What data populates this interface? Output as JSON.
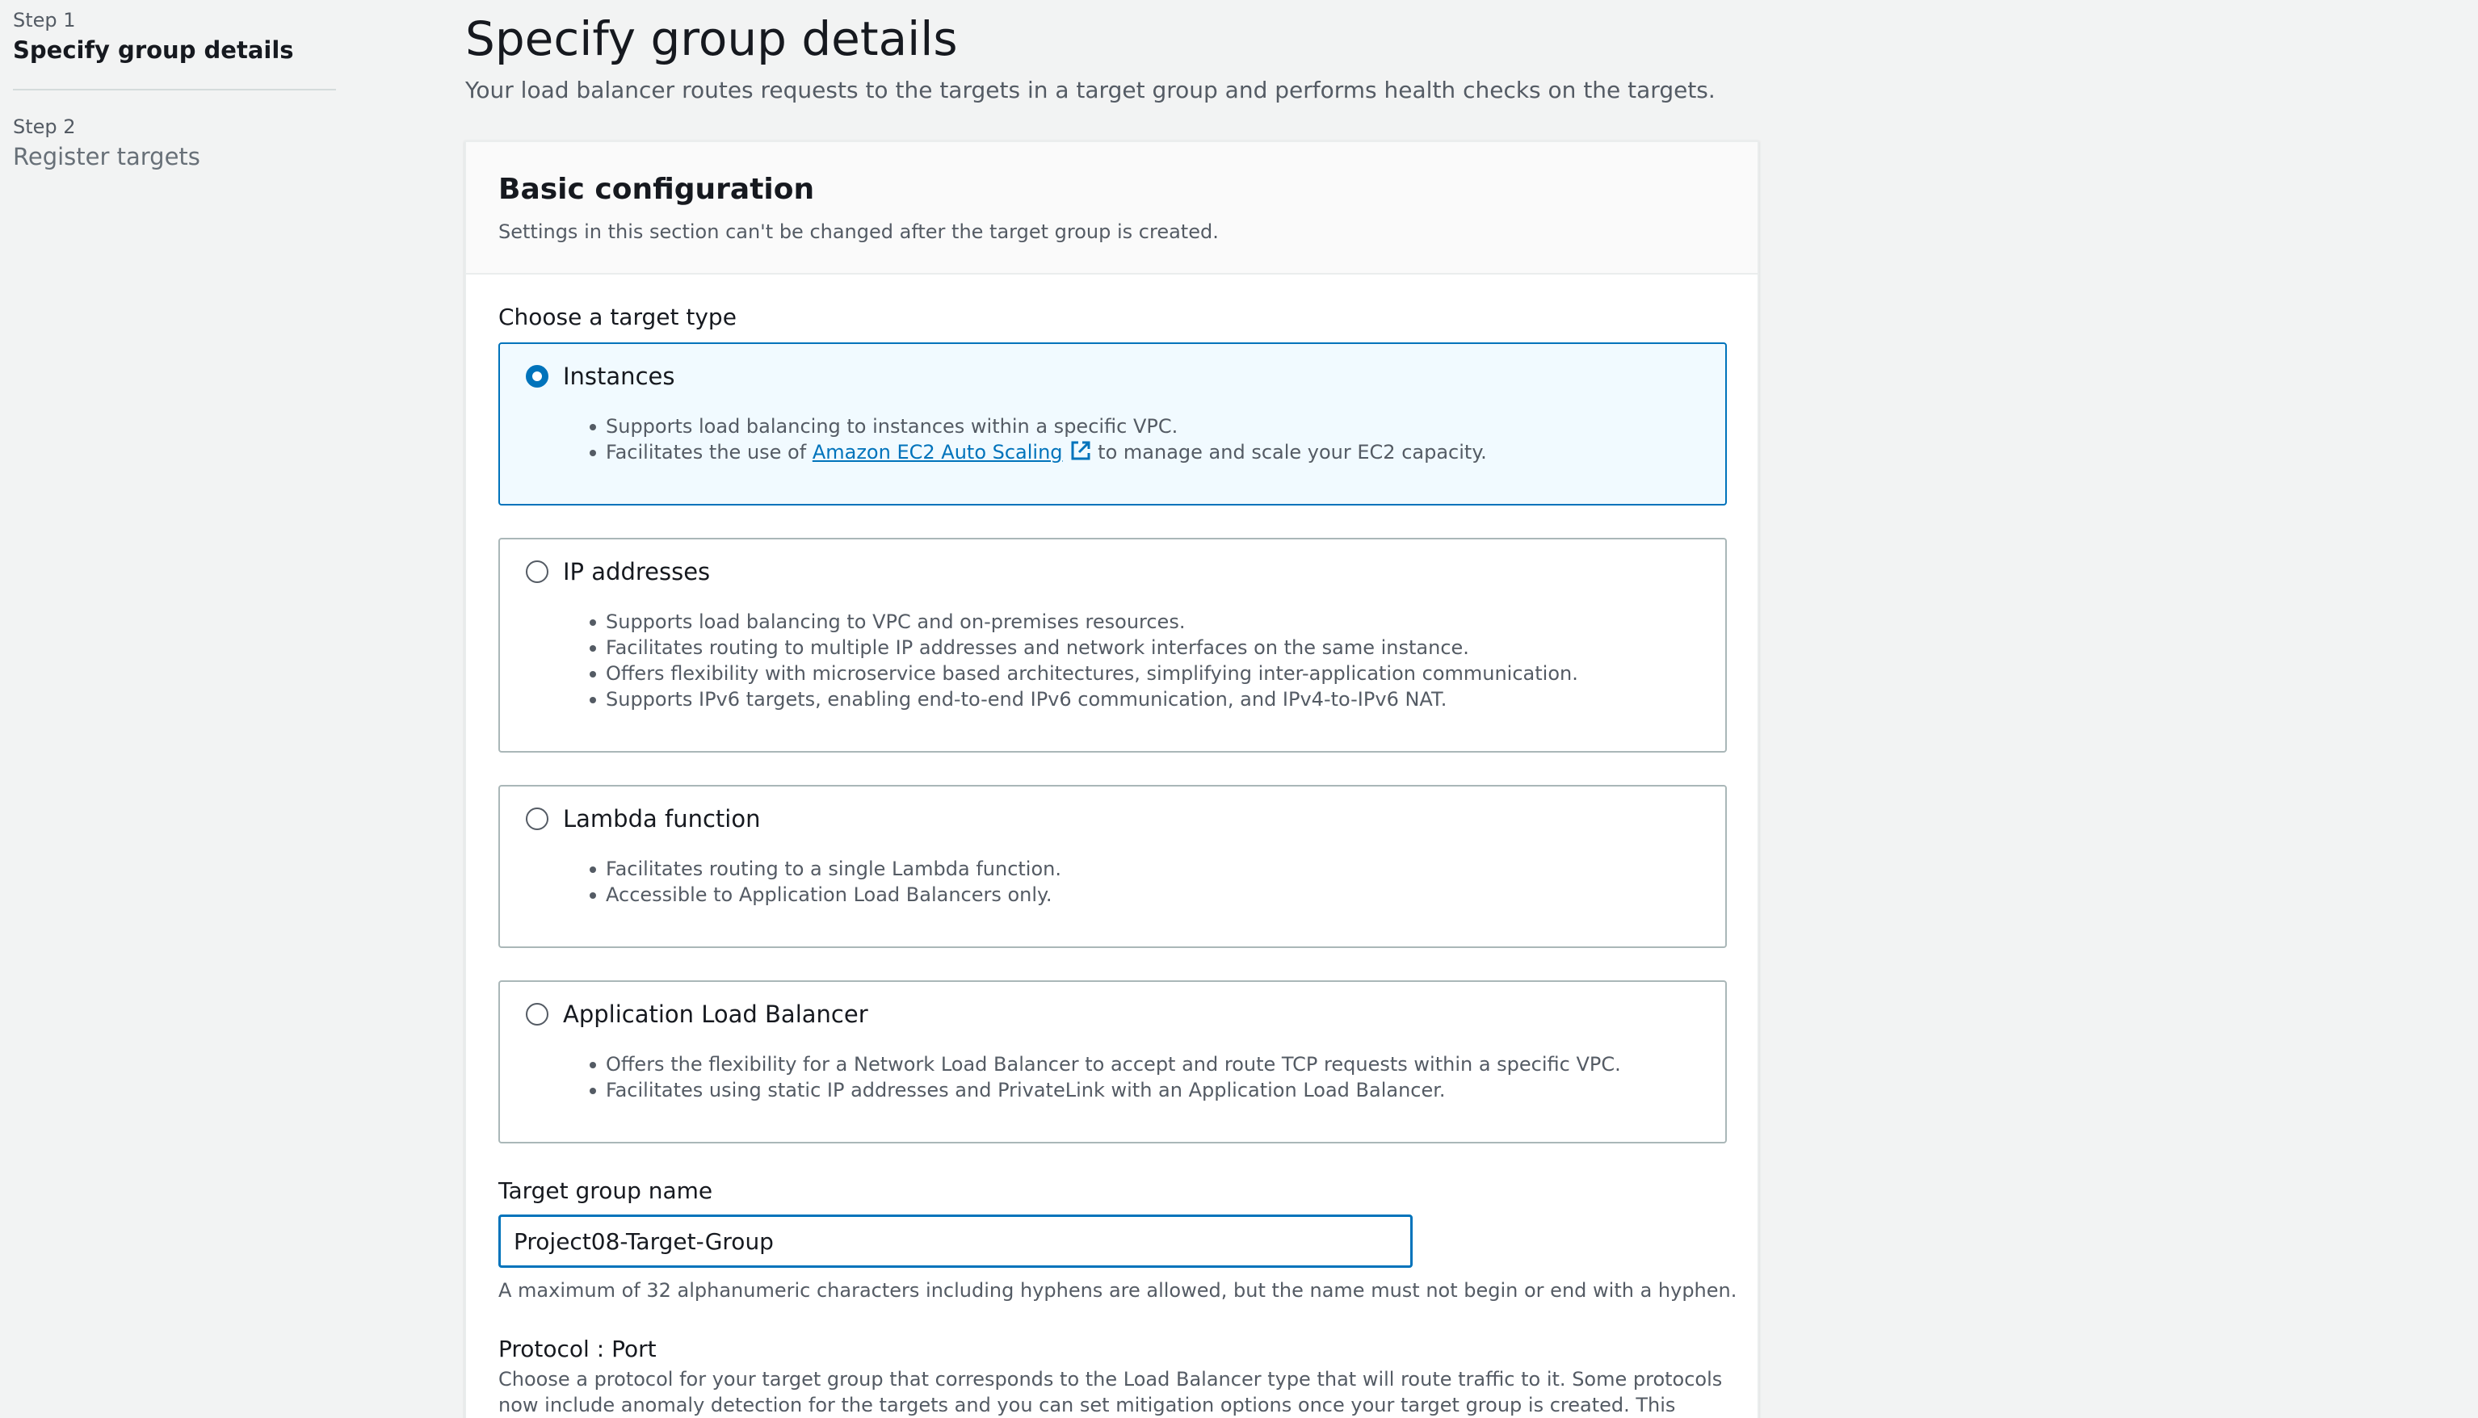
{
  "steps": [
    {
      "number": "Step 1",
      "title": "Specify group details"
    },
    {
      "number": "Step 2",
      "title": "Register targets"
    }
  ],
  "page": {
    "title": "Specify group details",
    "description": "Your load balancer routes requests to the targets in a target group and performs health checks on the targets."
  },
  "basic_config": {
    "title": "Basic configuration",
    "subtitle": "Settings in this section can't be changed after the target group is created.",
    "target_type_label": "Choose a target type",
    "options": [
      {
        "label": "Instances",
        "selected": true,
        "bullets": [
          "Supports load balancing to instances within a specific VPC."
        ],
        "bullet2_prefix": "Facilitates the use of ",
        "bullet2_link": "Amazon EC2 Auto Scaling",
        "bullet2_suffix": " to manage and scale your EC2 capacity."
      },
      {
        "label": "IP addresses",
        "selected": false,
        "bullets": [
          "Supports load balancing to VPC and on-premises resources.",
          "Facilitates routing to multiple IP addresses and network interfaces on the same instance.",
          "Offers flexibility with microservice based architectures, simplifying inter-application communication.",
          "Supports IPv6 targets, enabling end-to-end IPv6 communication, and IPv4-to-IPv6 NAT."
        ]
      },
      {
        "label": "Lambda function",
        "selected": false,
        "bullets": [
          "Facilitates routing to a single Lambda function.",
          "Accessible to Application Load Balancers only."
        ]
      },
      {
        "label": "Application Load Balancer",
        "selected": false,
        "bullets": [
          "Offers the flexibility for a Network Load Balancer to accept and route TCP requests within a specific VPC.",
          "Facilitates using static IP addresses and PrivateLink with an Application Load Balancer."
        ]
      }
    ],
    "name_label": "Target group name",
    "name_value": "Project08-Target-Group",
    "name_hint": "A maximum of 32 alphanumeric characters including hyphens are allowed, but the name must not begin or end with a hyphen.",
    "protocol_label": "Protocol : Port",
    "protocol_desc": "Choose a protocol for your target group that corresponds to the Load Balancer type that will route traffic to it. Some protocols now include anomaly detection for the targets and you can set mitigation options once your target group is created. This choice cannot be changed"
  },
  "colors": {
    "accent": "#0073bb",
    "selected_bg": "#f1faff",
    "page_bg": "#f2f3f3"
  },
  "icons": {
    "external_link": "external-link-icon"
  }
}
